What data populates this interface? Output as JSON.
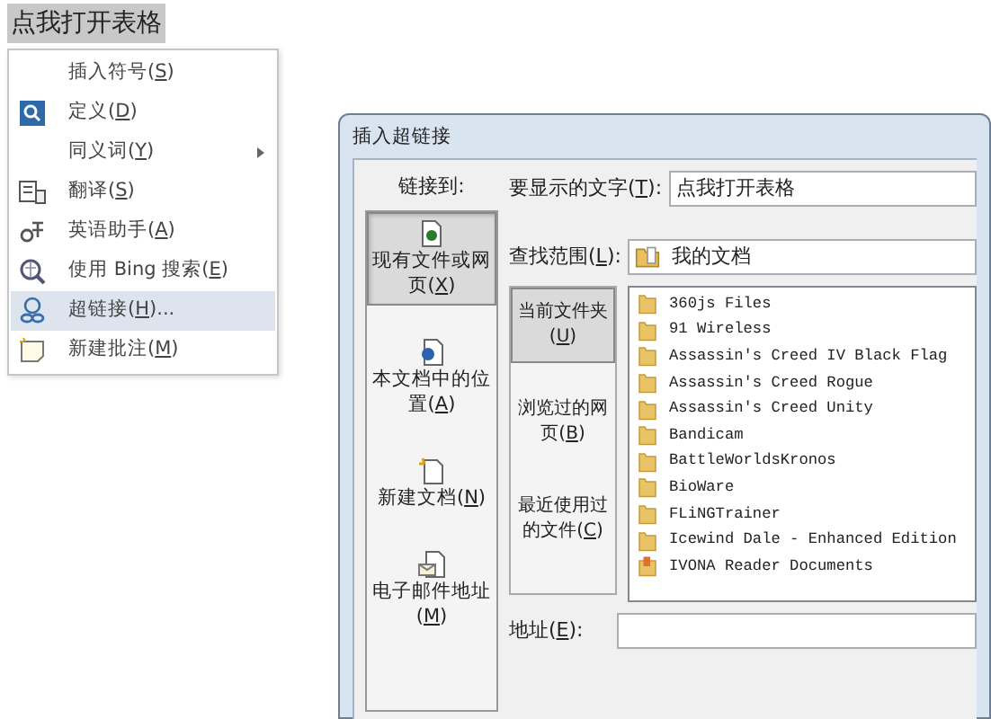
{
  "document": {
    "selected_text": "点我打开表格"
  },
  "context_menu": {
    "items": [
      {
        "label": "插入符号(S)",
        "submenu": false,
        "selected": false
      },
      {
        "label": "定义(D)",
        "submenu": false,
        "selected": false
      },
      {
        "label": "同义词(Y)",
        "submenu": true,
        "selected": false
      },
      {
        "label": "翻译(S)",
        "submenu": false,
        "selected": false
      },
      {
        "label": "英语助手(A)",
        "submenu": false,
        "selected": false
      },
      {
        "label": "使用 Bing 搜索(E)",
        "submenu": false,
        "selected": false
      },
      {
        "label": "超链接(H)...",
        "submenu": false,
        "selected": true
      },
      {
        "label": "新建批注(M)",
        "submenu": false,
        "selected": false
      }
    ]
  },
  "dialog": {
    "title": "插入超链接",
    "link_to_label": "链接到:",
    "link_to": [
      {
        "label": "现有文件或网页(X)",
        "selected": true
      },
      {
        "label": "本文档中的位置(A)",
        "selected": false
      },
      {
        "label": "新建文档(N)",
        "selected": false
      },
      {
        "label": "电子邮件地址(M)",
        "selected": false
      }
    ],
    "display_text": {
      "label": "要显示的文字(T):",
      "value": "点我打开表格"
    },
    "look_in": {
      "label": "查找范围(L):",
      "value": "我的文档"
    },
    "sources": [
      {
        "label": "当前文件夹(U)",
        "selected": true
      },
      {
        "label": "浏览过的网页(B)",
        "selected": false
      },
      {
        "label": "最近使用过的文件(C)",
        "selected": false
      }
    ],
    "files": [
      {
        "name": "360js Files",
        "kind": "folder"
      },
      {
        "name": "91 Wireless",
        "kind": "folder"
      },
      {
        "name": "Assassin's Creed IV Black Flag",
        "kind": "folder"
      },
      {
        "name": "Assassin's Creed Rogue",
        "kind": "folder"
      },
      {
        "name": "Assassin's Creed Unity",
        "kind": "folder"
      },
      {
        "name": "Bandicam",
        "kind": "folder"
      },
      {
        "name": "BattleWorldsKronos",
        "kind": "folder"
      },
      {
        "name": "BioWare",
        "kind": "folder"
      },
      {
        "name": "FLiNGTrainer",
        "kind": "folder"
      },
      {
        "name": "Icewind Dale - Enhanced Edition",
        "kind": "folder"
      },
      {
        "name": "IVONA Reader Documents",
        "kind": "special"
      }
    ],
    "address": {
      "label": "地址(E):"
    }
  }
}
